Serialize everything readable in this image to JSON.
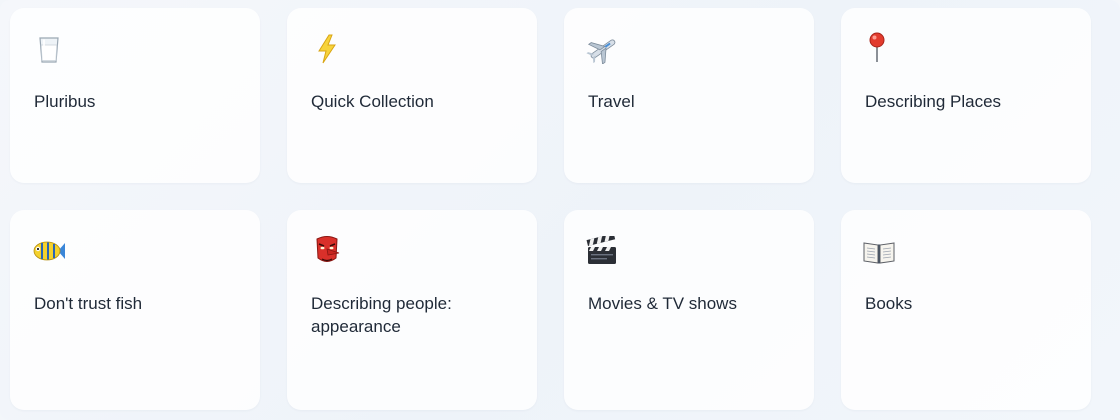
{
  "cards": [
    {
      "title": "Pluribus",
      "icon": "milk-glass-icon"
    },
    {
      "title": "Quick Collection",
      "icon": "lightning-icon"
    },
    {
      "title": "Travel",
      "icon": "airplane-icon"
    },
    {
      "title": "Describing Places",
      "icon": "pushpin-icon"
    },
    {
      "title": "Don't trust fish",
      "icon": "tropical-fish-icon"
    },
    {
      "title": "Describing people: appearance",
      "icon": "tengu-mask-icon"
    },
    {
      "title": "Movies & TV shows",
      "icon": "clapper-board-icon"
    },
    {
      "title": "Books",
      "icon": "open-book-icon"
    }
  ],
  "colors": {
    "card_bg": "#ffffff",
    "text": "#1f2937",
    "page_bg": "#f3f6fa"
  }
}
